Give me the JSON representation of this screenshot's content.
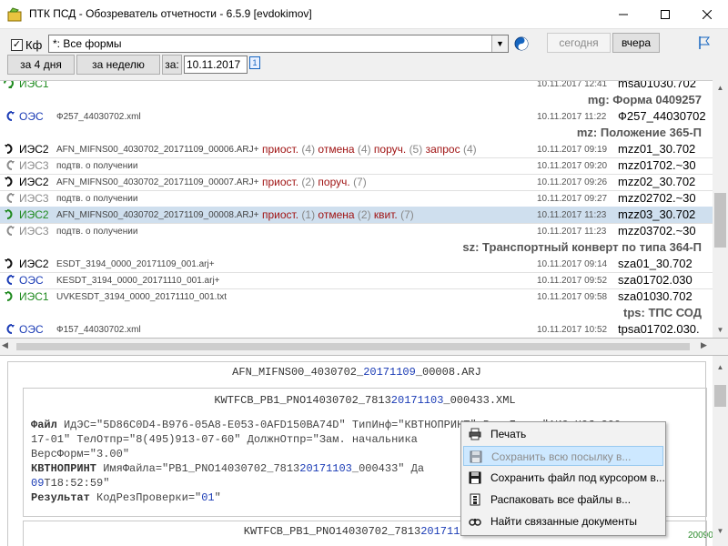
{
  "window": {
    "title": "ПТК ПСД - Обозреватель отчетности - 6.5.9 [evdokimov]",
    "controls": [
      "minimize",
      "maximize",
      "close"
    ]
  },
  "toolbar": {
    "kf_checked": true,
    "kf_label": "Кф",
    "filter_value": "*: Все формы",
    "today_label": "сегодня",
    "yesterday_label": "вчера",
    "four_days_label": "за 4 дня",
    "week_label": "за неделю",
    "date_prefix": "за:",
    "date_value": "10.11.2017",
    "calendar_glyph": "1"
  },
  "list": {
    "top_partial": {
      "type": "ИЭС1",
      "date": "10.11.2017 12:41",
      "code": "msa01030.702"
    },
    "sections": [
      {
        "title": "mg: Форма 0409257"
      },
      {
        "title": "mz: Положение 365-П"
      },
      {
        "title": "sz: Транспортный конверт по типа 364-П"
      },
      {
        "title": "tps: ТПС СОД"
      }
    ],
    "rows": [
      {
        "type": "ОЭС",
        "file": "Ф257_44030702.xml",
        "date": "10.11.2017 11:22",
        "code": "Ф257_44030702"
      },
      {
        "type": "ИЭС2",
        "file": "AFN_MIFNS00_4030702_20171109_00006.ARJ+",
        "tags": [
          {
            "word": "приост.",
            "count": "(4)"
          },
          {
            "word": "отмена",
            "count": "(4)"
          },
          {
            "word": "поруч.",
            "count": "(5)"
          },
          {
            "word": "запрос",
            "count": "(4)"
          }
        ],
        "date": "10.11.2017 09:19",
        "code": "mzz01_30.702"
      },
      {
        "type": "ИЭС3",
        "file": "подтв. о получении",
        "date": "10.11.2017 09:20",
        "code": "mzz01702.~30"
      },
      {
        "type": "ИЭС2",
        "file": "AFN_MIFNS00_4030702_20171109_00007.ARJ+",
        "tags": [
          {
            "word": "приост.",
            "count": "(2)"
          },
          {
            "word": "поруч.",
            "count": "(7)"
          }
        ],
        "date": "10.11.2017 09:26",
        "code": "mzz02_30.702"
      },
      {
        "type": "ИЭС3",
        "file": "подтв. о получении",
        "date": "10.11.2017 09:27",
        "code": "mzz02702.~30"
      },
      {
        "type": "ИЭС2",
        "file": "AFN_MIFNS00_4030702_20171109_00008.ARJ+",
        "tags": [
          {
            "word": "приост.",
            "count": "(1)"
          },
          {
            "word": "отмена",
            "count": "(2)"
          },
          {
            "word": "квит.",
            "count": "(7)"
          }
        ],
        "date": "10.11.2017 11:23",
        "code": "mzz03_30.702",
        "selected": true
      },
      {
        "type": "ИЭС3",
        "file": "подтв. о получении",
        "date": "10.11.2017 11:23",
        "code": "mzz03702.~30"
      },
      {
        "type": "ИЭС2",
        "file": "ESDT_3194_0000_20171109_001.arj+",
        "date": "10.11.2017 09:14",
        "code": "sza01_30.702"
      },
      {
        "type": "ОЭС",
        "file": "KESDT_3194_0000_20171110_001.arj+",
        "date": "10.11.2017 09:52",
        "code": "sza01702.030"
      },
      {
        "type": "ИЭС1",
        "file": "UVKESDT_3194_0000_20171110_001.txt",
        "date": "10.11.2017 09:58",
        "code": "sza01030.702"
      },
      {
        "type": "ОЭС",
        "file": "Ф157_44030702.xml",
        "date": "10.11.2017 10:52",
        "code": "tpsa01702.030."
      }
    ]
  },
  "preview": {
    "arj_name": {
      "pre": "AFN_MIFNS00_4030702_",
      "hl": "20171109",
      "post": "_00008.ARJ"
    },
    "xml_name": {
      "pre": "KWTFCB_PB1_PNO14030702_7813",
      "hl": "20171103",
      "post": "_000433.XML"
    },
    "xml_name2": {
      "pre": "KWTFCB_PB1_PNO14030702_7813",
      "hl": "20171103",
      "post": "_0"
    },
    "lines": {
      "l1": "ИдЭС=\"5D86C0D4-B976-05A8-E053-0AFD150BA74D\" ТипИнф=\"КВТНОПРИНТ\" ВерсПрог=\"АИС НОД 300-",
      "l1kw": "Файл",
      "l2": "17-01\" ТелОтпр=\"8(495)913-07-60\" ДолжнОтпр=\"Зам. начальника",
      "l3": "ВерсФорм=\"3.00\"",
      "l4kw": "КВТНОПРИНТ",
      "l4": " ИмяФайла=\"PB1_PNO14030702_7813",
      "l4hl": "20171103",
      "l4post": "_000433\" Да",
      "l5hl": "09",
      "l5": "T18:52:59\"",
      "l6kw": "Результат",
      "l6": " КодРезПроверки=\"",
      "l6hl": "01",
      "l6post": "\""
    },
    "tag": "200901]"
  },
  "context_menu": {
    "items": [
      {
        "label": "Печать",
        "icon": "printer-icon"
      },
      {
        "label": "Сохранить всю посылку в...",
        "icon": "floppy-icon",
        "state": "hover-disabled"
      },
      {
        "label": "Сохранить файл под курсором в...",
        "icon": "floppy-icon"
      },
      {
        "label": "Распаковать все файлы в...",
        "icon": "archive-icon"
      },
      {
        "label": "Найти связанные документы",
        "icon": "binoculars-icon"
      }
    ]
  },
  "colors": {
    "incoming_arrow": "#111111",
    "outgoing_arrow": "#1a3bb5",
    "ies1_arrow": "#1f8a1f",
    "ies3_arrow": "#8c8c8c",
    "selected_row": "#cfdfee",
    "tag_word": "#a01414",
    "menu_hover": "#cde8ff"
  }
}
